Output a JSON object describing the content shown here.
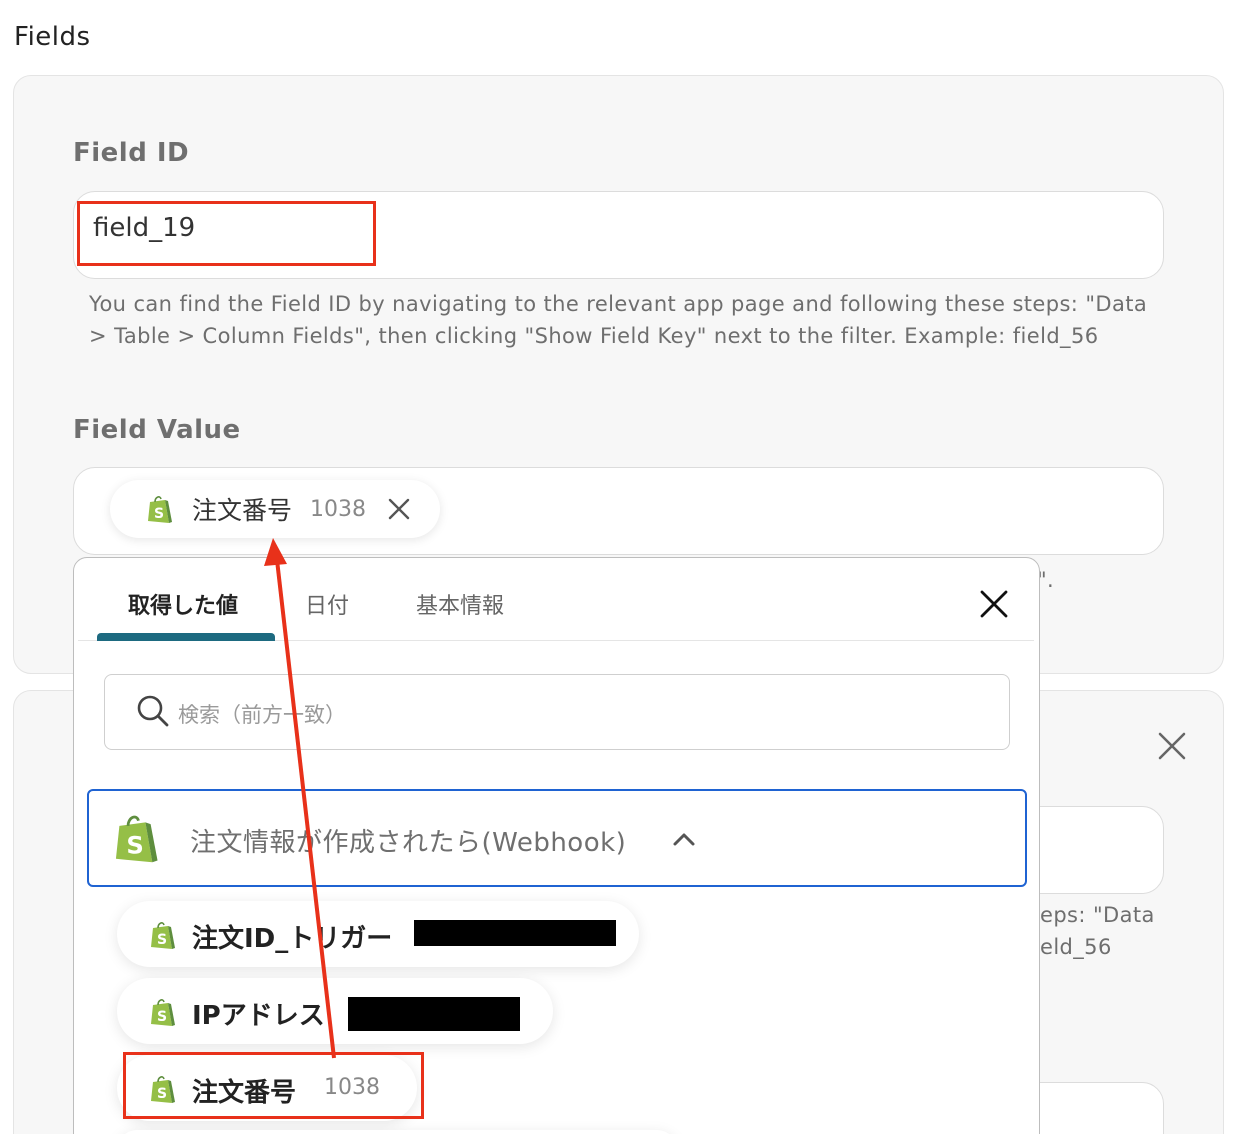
{
  "section_title": "Fields",
  "field_id": {
    "label": "Field ID",
    "value": "field_19",
    "help_line1": "You can find the Field ID by navigating to the relevant app page and following these steps: \"Data",
    "help_line2": "> Table > Column Fields\", then clicking \"Show Field Key\" next to the filter. Example: field_56"
  },
  "field_value": {
    "label": "Field Value",
    "chip": {
      "name": "注文番号",
      "value": "1038",
      "icon": "shopify-icon"
    },
    "peek_text": "\"."
  },
  "second_card": {
    "peek_help_line1": "eps: \"Data",
    "peek_help_line2": "eld_56"
  },
  "popup": {
    "tabs": [
      {
        "label": "取得した値",
        "active": true
      },
      {
        "label": "日付",
        "active": false
      },
      {
        "label": "基本情報",
        "active": false
      }
    ],
    "search_placeholder": "検索（前方一致）",
    "group": {
      "title": "注文情報が作成されたら(Webhook)",
      "icon": "shopify-icon",
      "expanded": true
    },
    "items": [
      {
        "name": "注文ID_トリガー",
        "value_redacted": true
      },
      {
        "name": "IPアドレス",
        "value_redacted": true
      },
      {
        "name": "注文番号",
        "value": "1038"
      }
    ]
  },
  "colors": {
    "accent_tab": "#1d6a80",
    "group_border": "#1f63d2",
    "annotation_red": "#e8311a",
    "shopify_green": "#95bf47"
  }
}
